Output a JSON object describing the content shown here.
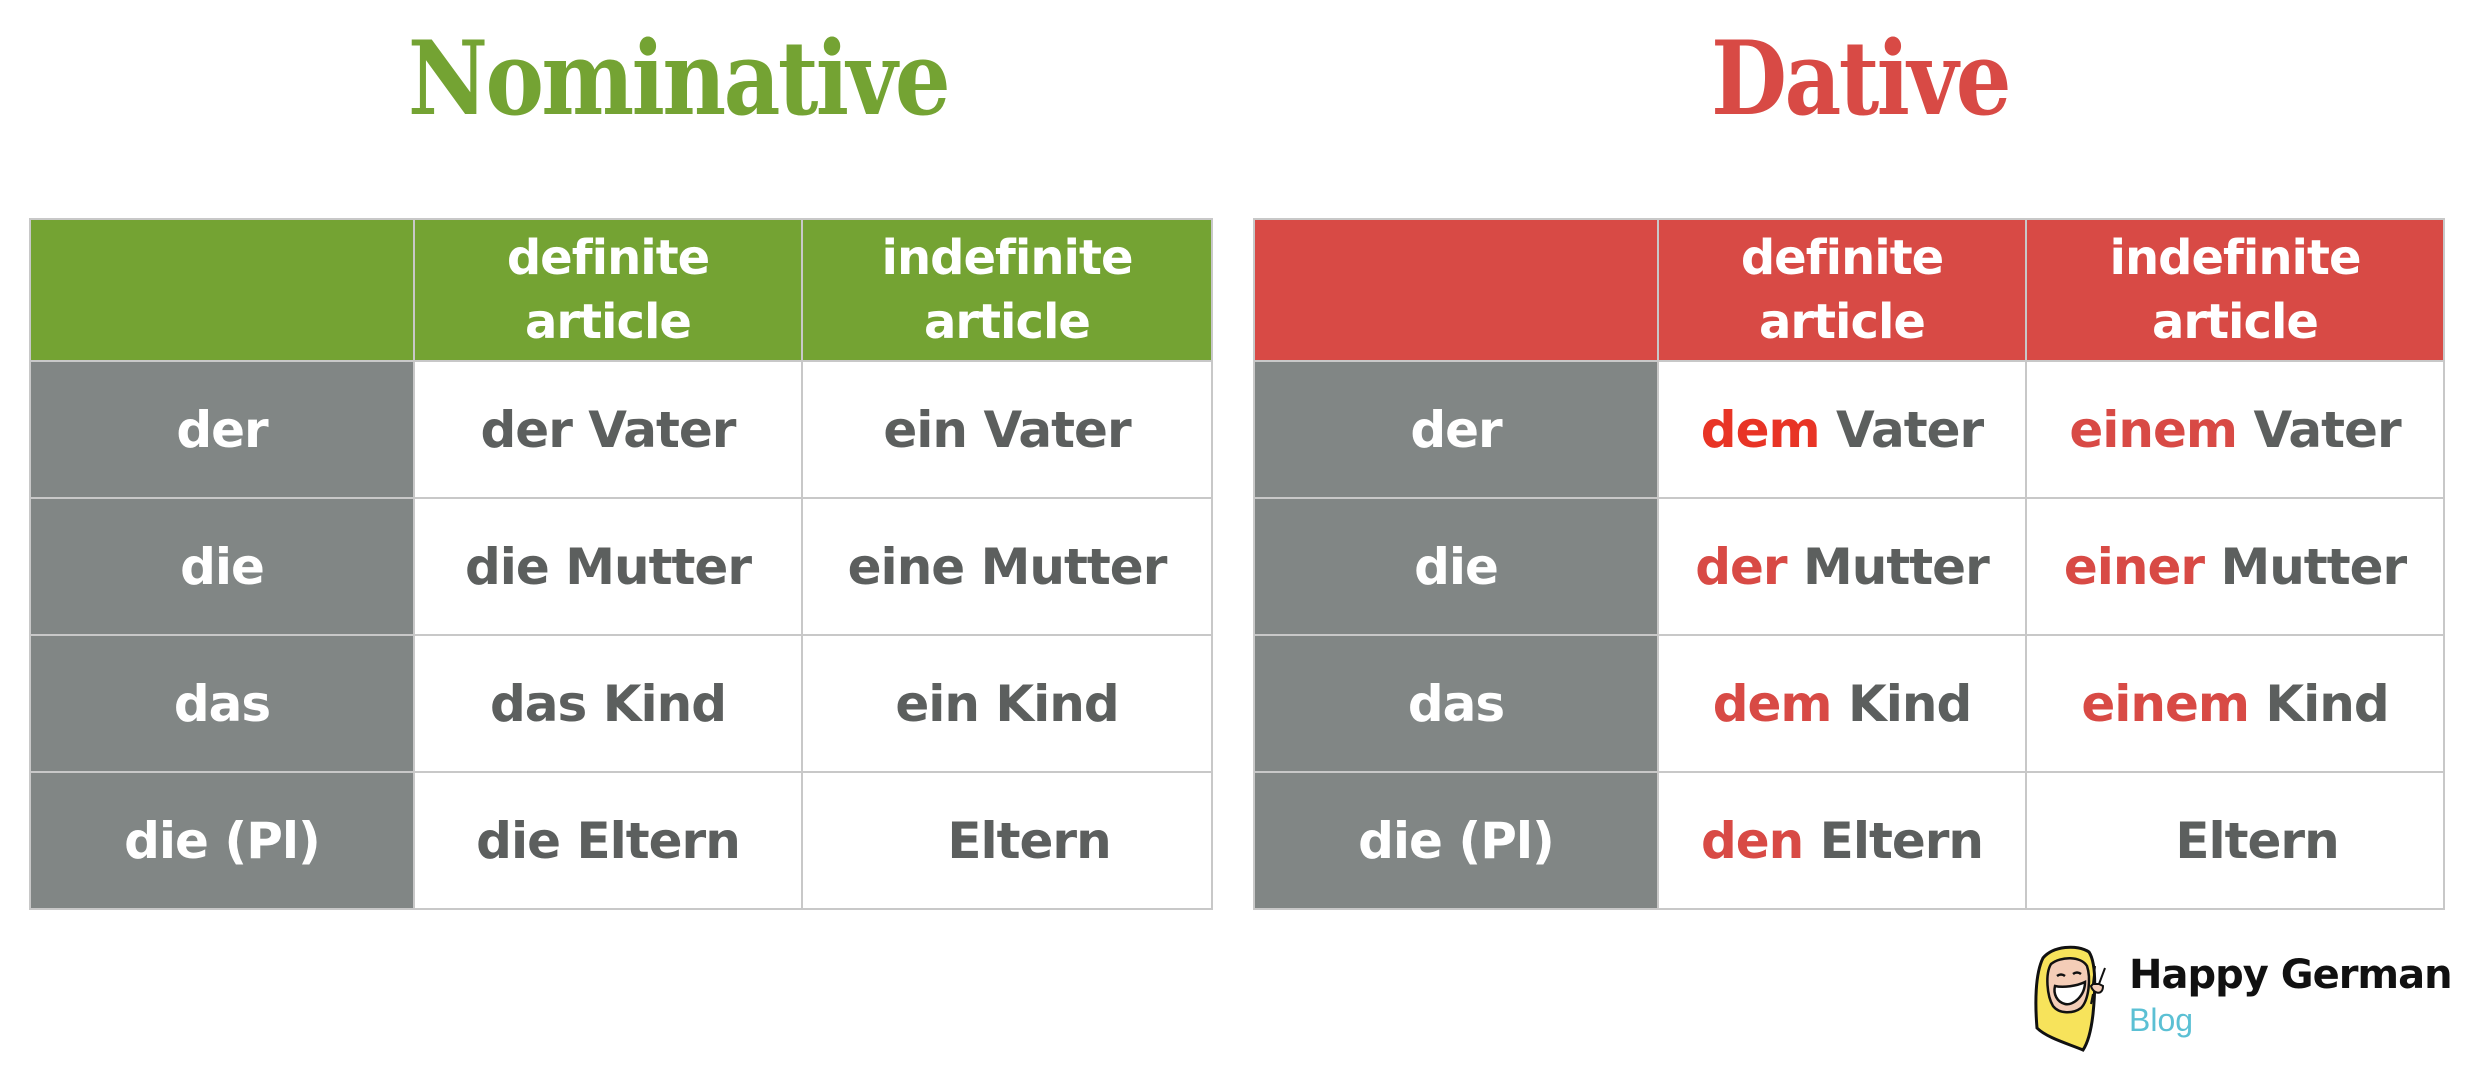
{
  "nominative": {
    "title": "Nominative",
    "color": "#74a333",
    "headers": [
      "",
      "definite|article",
      "indefinite|article"
    ],
    "header_lines": {
      "definite": [
        "definite",
        "article"
      ],
      "indefinite": [
        "indefinite",
        "article"
      ]
    },
    "rows": [
      {
        "label": "der",
        "definite": {
          "article": "der",
          "noun": "Vater"
        },
        "indefinite": {
          "article": "ein",
          "noun": "Vater"
        }
      },
      {
        "label": "die",
        "definite": {
          "article": "die",
          "noun": "Mutter"
        },
        "indefinite": {
          "article": "eine",
          "noun": "Mutter"
        }
      },
      {
        "label": "das",
        "definite": {
          "article": "das",
          "noun": "Kind"
        },
        "indefinite": {
          "article": "ein",
          "noun": "Kind"
        }
      },
      {
        "label": "die (Pl)",
        "definite": {
          "article": "die",
          "noun": "Eltern"
        },
        "indefinite": {
          "article": "",
          "noun": "Eltern"
        }
      }
    ]
  },
  "dative": {
    "title": "Dative",
    "color": "#d84a45",
    "highlight_color": "#d84a45",
    "header_lines": {
      "definite": [
        "definite",
        "article"
      ],
      "indefinite": [
        "indefinite",
        "article"
      ]
    },
    "rows": [
      {
        "label": "der",
        "definite": {
          "article": "dem",
          "noun": "Vater"
        },
        "indefinite": {
          "article": "einem",
          "noun": "Vater"
        }
      },
      {
        "label": "die",
        "definite": {
          "article": "der",
          "noun": "Mutter"
        },
        "indefinite": {
          "article": "einer",
          "noun": "Mutter"
        }
      },
      {
        "label": "das",
        "definite": {
          "article": "dem",
          "noun": "Kind"
        },
        "indefinite": {
          "article": "einem",
          "noun": "Kind"
        }
      },
      {
        "label": "die (Pl)",
        "definite": {
          "article": "den",
          "noun": "Eltern"
        },
        "indefinite": {
          "article": "",
          "noun": "Eltern"
        }
      }
    ]
  },
  "colors": {
    "nominative_green": "#74a333",
    "dative_red": "#d84a45",
    "row_label_gray": "#818685",
    "body_text": "#5c5f5e",
    "grid": "#c8c8c8"
  },
  "logo": {
    "icon": "smiling-face-peace-sign-icon",
    "brand": "Happy German",
    "sub": "Blog"
  }
}
